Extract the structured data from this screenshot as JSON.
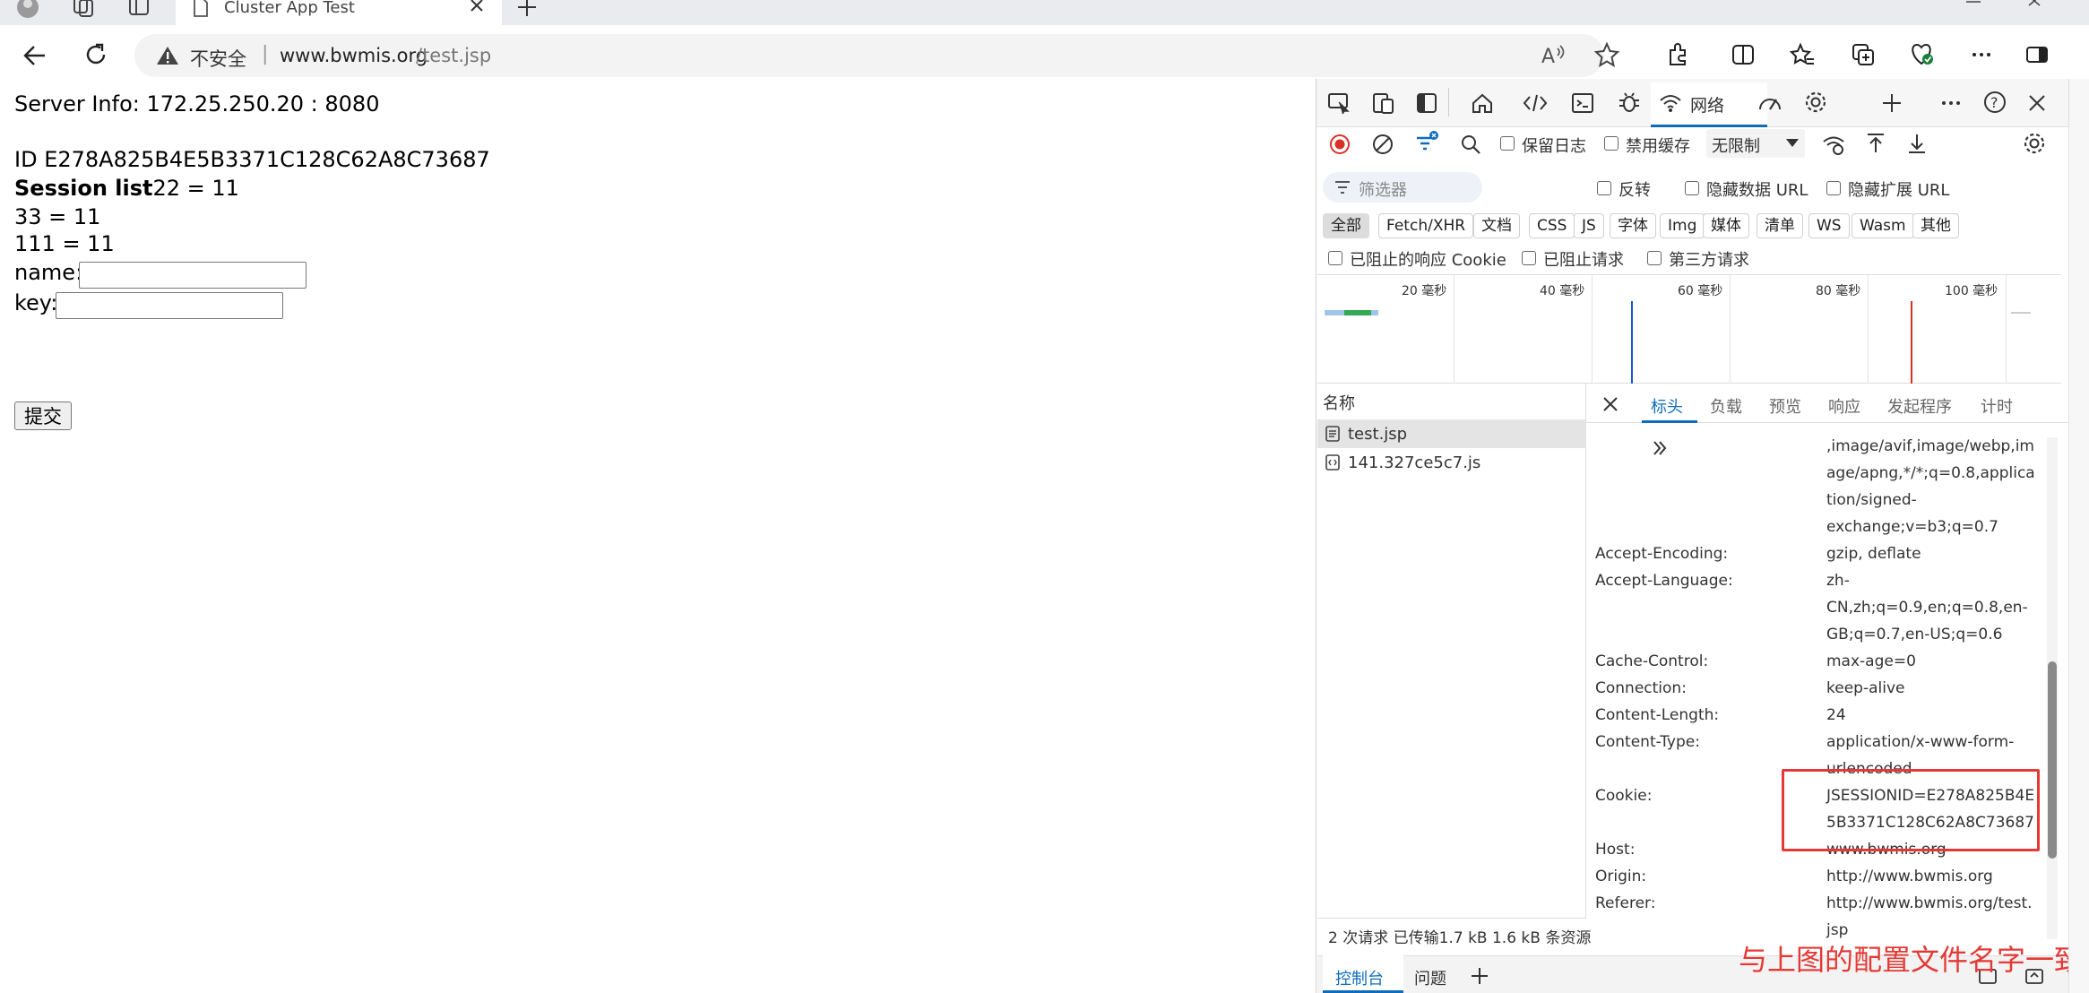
{
  "browser": {
    "tab_title": "Cluster App Test",
    "insecure_label": "不安全",
    "url_separator": "|",
    "url_host": "www.bwmis.org",
    "url_path": "/test.jsp"
  },
  "page": {
    "server_info": "Server Info: 172.25.250.20 : 8080",
    "session_id": "ID E278A825B4E5B3371C128C62A8C73687",
    "session_list_label": "Session list",
    "session_entries": [
      "22 = 11",
      "33 = 11",
      "111 = 11"
    ],
    "name_label": "name:",
    "key_label": "key:",
    "submit_label": "提交"
  },
  "devtools": {
    "network_tab": "网络",
    "preserve_log": "保留日志",
    "disable_cache": "禁用缓存",
    "throttle": "无限制",
    "filter_placeholder": "筛选器",
    "invert": "反转",
    "hide_data_urls": "隐藏数据 URL",
    "hide_ext_urls": "隐藏扩展 URL",
    "type_filters": [
      "全部",
      "Fetch/XHR",
      "文档",
      "CSS",
      "JS",
      "字体",
      "Img",
      "媒体",
      "清单",
      "WS",
      "Wasm",
      "其他"
    ],
    "blocked_cookies": "已阻止的响应 Cookie",
    "blocked_requests": "已阻止请求",
    "third_party": "第三方请求",
    "timeline_ticks": [
      "20 毫秒",
      "40 毫秒",
      "60 毫秒",
      "80 毫秒",
      "100 毫秒"
    ],
    "name_column": "名称",
    "requests": [
      "test.jsp",
      "141.327ce5c7.js"
    ],
    "status_bar": "2 次请求  已传输1.7 kB  1.6 kB 条资源",
    "detail_tabs": [
      "标头",
      "负载",
      "预览",
      "响应",
      "发起程序",
      "计时"
    ],
    "headers": [
      {
        "name": "",
        "value": ",image/avif,image/webp,im"
      },
      {
        "name": "",
        "value": "age/apng,*/*;q=0.8,applica"
      },
      {
        "name": "",
        "value": "tion/signed-"
      },
      {
        "name": "",
        "value": "exchange;v=b3;q=0.7"
      },
      {
        "name": "Accept-Encoding:",
        "value": "gzip, deflate"
      },
      {
        "name": "Accept-Language:",
        "value": "zh-"
      },
      {
        "name": "",
        "value": "CN,zh;q=0.9,en;q=0.8,en-"
      },
      {
        "name": "",
        "value": "GB;q=0.7,en-US;q=0.6"
      },
      {
        "name": "Cache-Control:",
        "value": "max-age=0"
      },
      {
        "name": "Connection:",
        "value": "keep-alive"
      },
      {
        "name": "Content-Length:",
        "value": "24"
      },
      {
        "name": "Content-Type:",
        "value": "application/x-www-form-"
      },
      {
        "name": "",
        "value": "urlencoded"
      },
      {
        "name": "Cookie:",
        "value": "JSESSIONID=E278A825B4E"
      },
      {
        "name": "",
        "value": "5B3371C128C62A8C73687"
      },
      {
        "name": "Host:",
        "value": "www.bwmis.org"
      },
      {
        "name": "Origin:",
        "value": "http://www.bwmis.org"
      },
      {
        "name": "Referer:",
        "value": "http://www.bwmis.org/test."
      },
      {
        "name": "",
        "value": "jsp"
      }
    ],
    "console_tab": "控制台",
    "issues_tab": "问题",
    "annotation": "与上图的配置文件名字一致",
    "highlight_color": "#e53935",
    "accent_color": "#0f6cbd"
  }
}
